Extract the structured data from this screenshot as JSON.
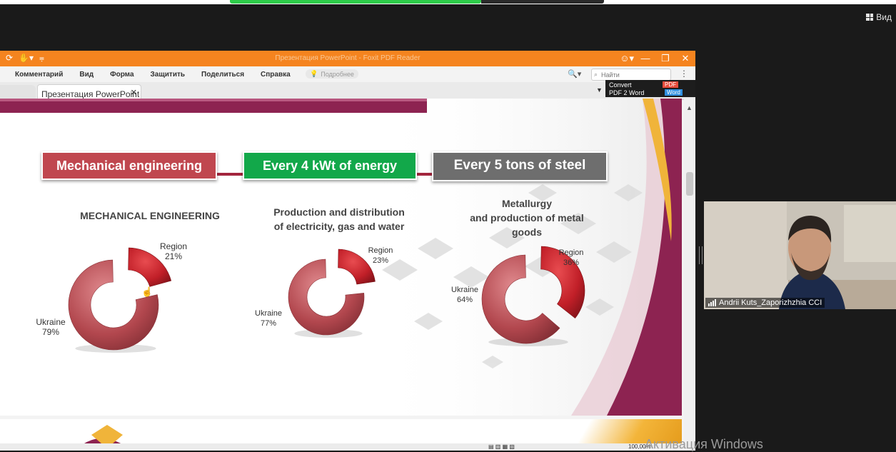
{
  "meeting": {
    "view_label": "Вид"
  },
  "app": {
    "title": "Презентация PowerPoint - Foxit PDF Reader",
    "menu": [
      "Комментарий",
      "Вид",
      "Форма",
      "Защитить",
      "Поделиться",
      "Справка"
    ],
    "hint": "Подробнее",
    "search_placeholder": "Найти",
    "tab_label": "Презентация PowerPoint",
    "convert": {
      "line1": "Convert",
      "line2": "PDF 2 Word",
      "pdf_badge": "PDF",
      "word_badge": "Word"
    },
    "status_zoom": "100,00%"
  },
  "slide": {
    "headers": [
      "Mechanical engineering",
      "Every 4 kWt  of energy",
      "Every 5 tons of steel"
    ],
    "charts_titles": {
      "c1": [
        "MECHANICAL ENGINEERING"
      ],
      "c2": [
        "Production and distribution",
        "of electricity, gas and water"
      ],
      "c3": [
        "Metallurgy",
        "and production of metal",
        "goods"
      ]
    }
  },
  "chart_data": [
    {
      "type": "pie",
      "title": "MECHANICAL ENGINEERING",
      "categories": [
        "Region",
        "Ukraine"
      ],
      "values": [
        21,
        79
      ],
      "labels": [
        "21%",
        "79%"
      ],
      "colors": [
        "#c0202a",
        "#b04a50"
      ]
    },
    {
      "type": "pie",
      "title": "Production and distribution of electricity, gas and water",
      "categories": [
        "Region",
        "Ukraine"
      ],
      "values": [
        23,
        77
      ],
      "labels": [
        "23%",
        "77%"
      ],
      "colors": [
        "#c0202a",
        "#b04a50"
      ]
    },
    {
      "type": "pie",
      "title": "Metallurgy and production of metal goods",
      "categories": [
        "Region",
        "Ukraine"
      ],
      "values": [
        36,
        64
      ],
      "labels": [
        "36%",
        "64%"
      ],
      "colors": [
        "#c0202a",
        "#b04a50"
      ]
    }
  ],
  "video": {
    "participant_name": "Andrii Kuts_Zaporizhzhia CCI"
  },
  "os": {
    "activation_text": "Активация Windows"
  }
}
